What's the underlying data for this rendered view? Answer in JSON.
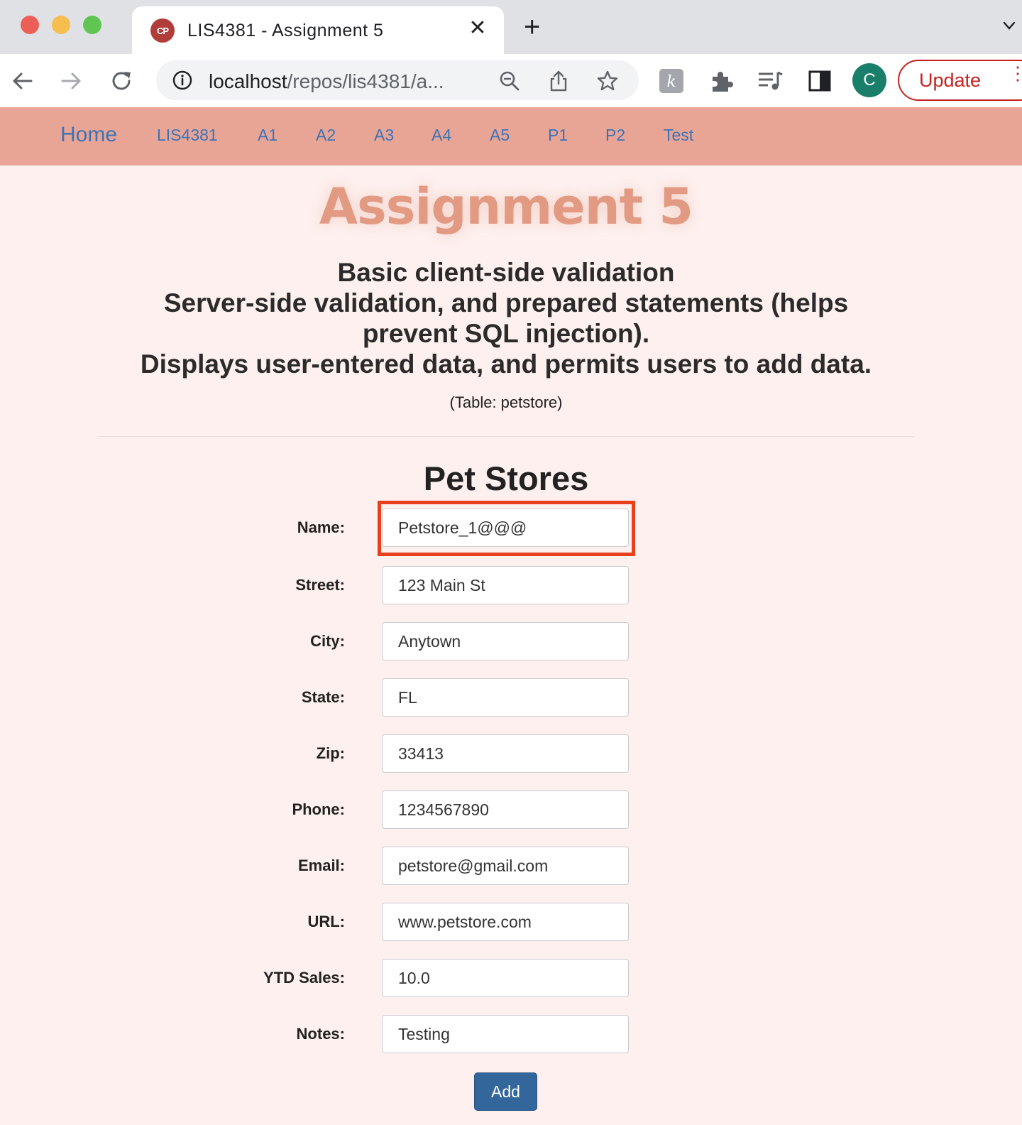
{
  "browser": {
    "tab": {
      "favicon_text": "CP",
      "title": "LIS4381 - Assignment 5",
      "close_glyph": "✕"
    },
    "new_tab_glyph": "+",
    "address_bar": {
      "host": "localhost",
      "path": "/repos/lis4381/a..."
    },
    "profile_initial": "C",
    "update_label": "Update",
    "menu_glyph": "⋮",
    "icons": [
      "back-arrow-icon",
      "forward-arrow-icon",
      "reload-icon",
      "info-icon",
      "zoom-icon",
      "share-icon",
      "star-icon",
      "extension-k-icon",
      "puzzle-icon",
      "media-queue-icon",
      "sidepanel-icon",
      "chevron-down-icon"
    ]
  },
  "site_nav": {
    "brand": "Home",
    "links": [
      "LIS4381",
      "A1",
      "A2",
      "A3",
      "A4",
      "A5",
      "P1",
      "P2",
      "Test"
    ],
    "colors": {
      "bar": "#e8a596",
      "link": "#3d73b5"
    }
  },
  "page": {
    "title": "Assignment 5",
    "description": [
      "Basic client-side validation",
      "Server-side validation, and prepared statements (helps",
      "prevent SQL injection).",
      "Displays user-entered data, and permits users to add data."
    ],
    "table_note": "(Table: petstore)",
    "title_color": "#e39a83"
  },
  "form": {
    "title": "Pet Stores",
    "fields": [
      {
        "label": "Name:",
        "value": "Petstore_1@@@",
        "highlighted": true
      },
      {
        "label": "Street:",
        "value": "123 Main St"
      },
      {
        "label": "City:",
        "value": "Anytown"
      },
      {
        "label": "State:",
        "value": "FL"
      },
      {
        "label": "Zip:",
        "value": "33413"
      },
      {
        "label": "Phone:",
        "value": "1234567890"
      },
      {
        "label": "Email:",
        "value": "petstore@gmail.com"
      },
      {
        "label": "URL:",
        "value": "www.petstore.com"
      },
      {
        "label": "YTD Sales:",
        "value": "10.0"
      },
      {
        "label": "Notes:",
        "value": "Testing"
      }
    ],
    "submit_label": "Add",
    "highlight_color": "#e8401c",
    "button_color": "#33669a"
  }
}
